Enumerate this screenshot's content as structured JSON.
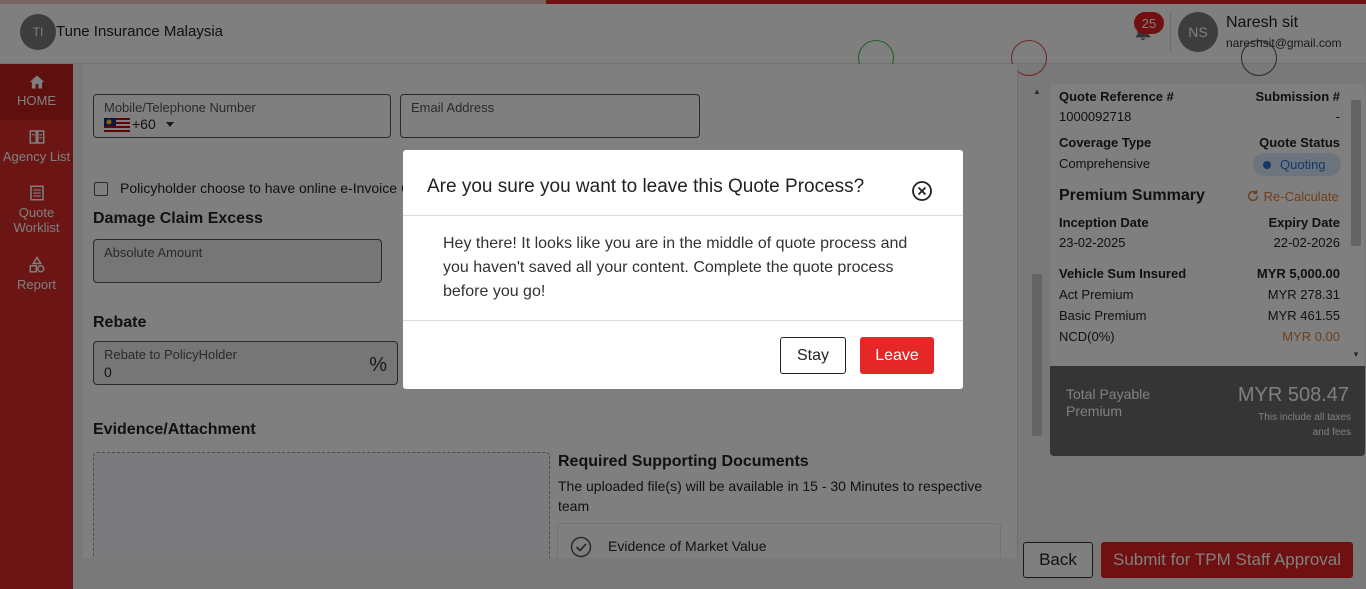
{
  "header": {
    "org_initials": "TI",
    "org_name": "Tune Insurance Malaysia",
    "notification_count": "25",
    "user_initials": "NS",
    "user_name": "Naresh sit",
    "user_email": "nareshsit@gmail.com"
  },
  "progress_percent": 60,
  "sidebar": {
    "items": [
      {
        "label": "HOME",
        "icon": "home-icon",
        "active": true
      },
      {
        "label": "Agency List",
        "icon": "agency-list-icon"
      },
      {
        "label": "Quote Worklist",
        "icon": "quote-worklist-icon"
      },
      {
        "label": "Report",
        "icon": "report-icon"
      }
    ]
  },
  "form": {
    "mobile_label": "Mobile/Telephone Number",
    "country_code": "+60",
    "email_label": "Email Address",
    "einvoice_label": "Policyholder choose to have online e-Invoice C",
    "damage_title": "Damage Claim Excess",
    "absolute_label": "Absolute Amount",
    "rebate_title": "Rebate",
    "rebate_label": "Rebate to PolicyHolder",
    "rebate_value": "0",
    "rebate_unit": "%",
    "evidence_title": "Evidence/Attachment",
    "required_title": "Required Supporting Documents",
    "required_text": "The uploaded file(s) will be available in 15 - 30 Minutes to respective team",
    "doc_item": "Evidence of Market Value"
  },
  "summary": {
    "quote_ref_label": "Quote Reference #",
    "quote_ref_value": "1000092718",
    "submission_label": "Submission #",
    "submission_value": "-",
    "coverage_label": "Coverage Type",
    "coverage_value": "Comprehensive",
    "status_label": "Quote Status",
    "status_value": "Quoting",
    "premium_title": "Premium Summary",
    "recalc_label": "Re-Calculate",
    "inception_label": "Inception Date",
    "inception_value": "23-02-2025",
    "expiry_label": "Expiry Date",
    "expiry_value": "22-02-2026",
    "sum_insured_label": "Vehicle Sum Insured",
    "sum_insured_value": "MYR 5,000.00",
    "act_label": "Act Premium",
    "act_value": "MYR 278.31",
    "basic_label": "Basic Premium",
    "basic_value": "MYR 461.55",
    "ncd_label": "NCD(0%)",
    "ncd_value": "MYR 0.00",
    "total_label": "Total Payable Premium",
    "total_value": "MYR 508.47",
    "total_note": "This include all taxes and fees"
  },
  "actions": {
    "back_label": "Back",
    "submit_label": "Submit for TPM Staff Approval"
  },
  "modal": {
    "title": "Are you sure you want to leave this Quote Process?",
    "body": "Hey there! It looks like you are in the middle of quote process and you haven't saved all your content. Complete the quote process before you go!",
    "stay_label": "Stay",
    "leave_label": "Leave"
  },
  "colors": {
    "brand_red": "#d62b2b",
    "button_red": "#e02020",
    "status_blue": "#2a6fd8",
    "ncd_orange": "#e0803a"
  }
}
